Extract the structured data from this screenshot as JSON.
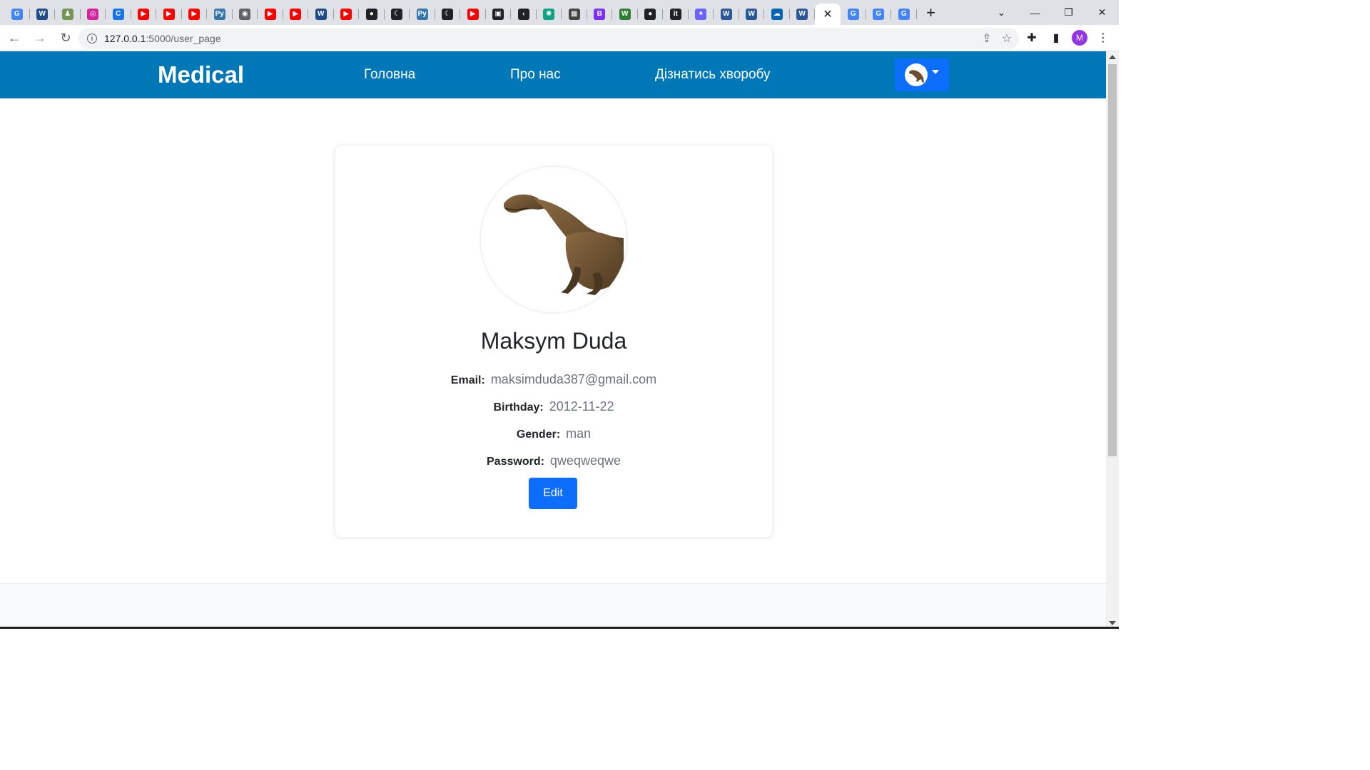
{
  "browser": {
    "tabs": [
      {
        "icon": "google-translate-icon",
        "glyph": "G",
        "color": "#4285f4"
      },
      {
        "icon": "wordpress-icon",
        "glyph": "W",
        "color": "#1e4a8a"
      },
      {
        "icon": "chess-icon",
        "glyph": "♟",
        "color": "#769656"
      },
      {
        "icon": "instagram-icon",
        "glyph": "◎",
        "color": "#d6249f"
      },
      {
        "icon": "c-icon",
        "glyph": "C",
        "color": "#1a73e8"
      },
      {
        "icon": "youtube-icon",
        "glyph": "▶",
        "color": "#ff0000"
      },
      {
        "icon": "youtube-icon",
        "glyph": "▶",
        "color": "#ff0000"
      },
      {
        "icon": "youtube-icon",
        "glyph": "▶",
        "color": "#ff0000"
      },
      {
        "icon": "python-icon",
        "glyph": "Py",
        "color": "#3776ab"
      },
      {
        "icon": "location-icon",
        "glyph": "◉",
        "color": "#5f6368"
      },
      {
        "icon": "youtube-icon",
        "glyph": "▶",
        "color": "#ff0000"
      },
      {
        "icon": "youtube-icon",
        "glyph": "▶",
        "color": "#ff0000"
      },
      {
        "icon": "wordpress-icon",
        "glyph": "W",
        "color": "#1e4a8a"
      },
      {
        "icon": "youtube-icon",
        "glyph": "▶",
        "color": "#ff0000"
      },
      {
        "icon": "globe-icon",
        "glyph": "●",
        "color": "#202124"
      },
      {
        "icon": "moon-icon",
        "glyph": "☾",
        "color": "#202124"
      },
      {
        "icon": "python-icon",
        "glyph": "Py",
        "color": "#3776ab"
      },
      {
        "icon": "moon-icon",
        "glyph": "☾",
        "color": "#202124"
      },
      {
        "icon": "youtube-icon",
        "glyph": "▶",
        "color": "#ff0000"
      },
      {
        "icon": "dark-app-icon",
        "glyph": "▣",
        "color": "#202124"
      },
      {
        "icon": "chevron-icon",
        "glyph": "‹",
        "color": "#202124"
      },
      {
        "icon": "openai-icon",
        "glyph": "✺",
        "color": "#10a37f"
      },
      {
        "icon": "film-icon",
        "glyph": "▦",
        "color": "#444444"
      },
      {
        "icon": "b-icon",
        "glyph": "B",
        "color": "#7b2ff7"
      },
      {
        "icon": "w-icon",
        "glyph": "W",
        "color": "#2e7d32"
      },
      {
        "icon": "github-icon",
        "glyph": "●",
        "color": "#202124"
      },
      {
        "icon": "it-icon",
        "glyph": "it",
        "color": "#202124"
      },
      {
        "icon": "app-icon",
        "glyph": "✦",
        "color": "#6c63ff"
      },
      {
        "icon": "word-icon",
        "glyph": "W",
        "color": "#2b579a"
      },
      {
        "icon": "word-icon",
        "glyph": "W",
        "color": "#2b579a"
      },
      {
        "icon": "onedrive-icon",
        "glyph": "☁",
        "color": "#0364b8"
      },
      {
        "icon": "word-icon",
        "glyph": "W",
        "color": "#2b579a"
      },
      {
        "icon": "close-icon",
        "glyph": "✕",
        "color": "#202124",
        "active": true
      },
      {
        "icon": "google-icon",
        "glyph": "G",
        "color": "#4285f4"
      },
      {
        "icon": "google-icon",
        "glyph": "G",
        "color": "#4285f4"
      },
      {
        "icon": "google-icon",
        "glyph": "G",
        "color": "#4285f4"
      }
    ],
    "url_host": "127.0.0.1",
    "url_rest": ":5000/user_page",
    "profile_initial": "M"
  },
  "site": {
    "brand": "Medical",
    "nav": {
      "home": "Головна",
      "about": "Про нас",
      "diagnose": "Дізнатись хворобу"
    },
    "nav_color": "#0077b6",
    "accent": "#0d6efd"
  },
  "profile": {
    "name": "Maksym Duda",
    "fields": [
      {
        "label": "Email:",
        "value": "maksimduda387@gmail.com"
      },
      {
        "label": "Birthday:",
        "value": "2012-11-22"
      },
      {
        "label": "Gender:",
        "value": "man"
      },
      {
        "label": "Password:",
        "value": "qweqweqwe"
      }
    ],
    "edit_label": "Edit"
  }
}
